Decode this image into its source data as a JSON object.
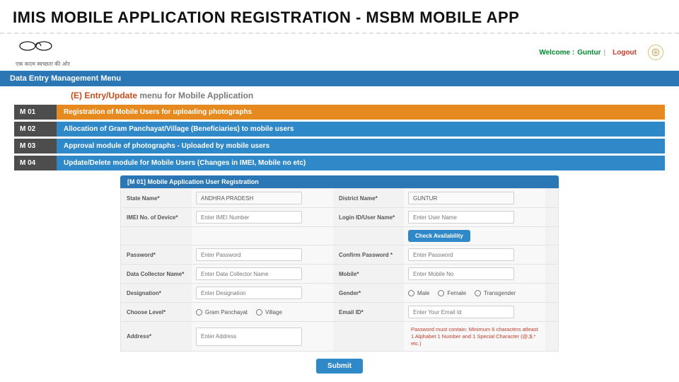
{
  "pageTitle": "IMIS MOBILE APPLICATION REGISTRATION - MSBM MOBILE APP",
  "topbar": {
    "tagline": "एक कदम स्वच्छता की ओर",
    "welcome": "Welcome :",
    "user": "Guntur",
    "sep": "|",
    "logout": "Logout"
  },
  "blueBar": "Data Entry Management Menu",
  "sectionHeading_pre": "(E) Entry/Update ",
  "sectionHeading_mid": "menu for Mobile Application",
  "menu": [
    {
      "code": "M 01",
      "label": "Registration of Mobile Users for uploading photographs"
    },
    {
      "code": "M 02",
      "label": "Allocation of Gram Panchayat/Village (Beneficiaries) to mobile users"
    },
    {
      "code": "M 03",
      "label": "Approval module of photographs - Uploaded by mobile users"
    },
    {
      "code": "M 04",
      "label": "Update/Delete module for Mobile Users (Changes in IMEI, Mobile no etc)"
    }
  ],
  "form": {
    "title": "[M 01] Mobile Application User Registration",
    "labels": {
      "state": "State Name*",
      "district": "District Name*",
      "imei": "IMEI No. of Device*",
      "login": "Login ID/User Name*",
      "password": "Password*",
      "confirm": "Confirm Password *",
      "collector": "Data Collector Name*",
      "mobile": "Mobile*",
      "designation": "Designation*",
      "gender": "Gender*",
      "level": "Choose Level*",
      "email": "Email ID*",
      "address": "Address*"
    },
    "values": {
      "state": "ANDHRA PRADESH",
      "district": "GUNTUR"
    },
    "placeholders": {
      "imei": "Enter IMEI Number",
      "login": "Enter User Name",
      "password": "Enter Password",
      "confirm": "Enter Password",
      "collector": "Enter Data Collector Name",
      "mobile": "Enter Mobile No",
      "designation": "Enter Designation",
      "email": "Enter Your Email Id",
      "address": "Enter Address"
    },
    "genderOptions": {
      "m": "Male",
      "f": "Female",
      "t": "Transgender"
    },
    "levelOptions": {
      "gp": "Gram Panchayat",
      "v": "Village"
    },
    "checkAvailability": "Check Availability",
    "hint": "Password must contain: Minimum 6 characters atleast 1 Alphabet 1 Number and 1 Special Character (@,$,* etc.)",
    "submit": "Submit"
  }
}
